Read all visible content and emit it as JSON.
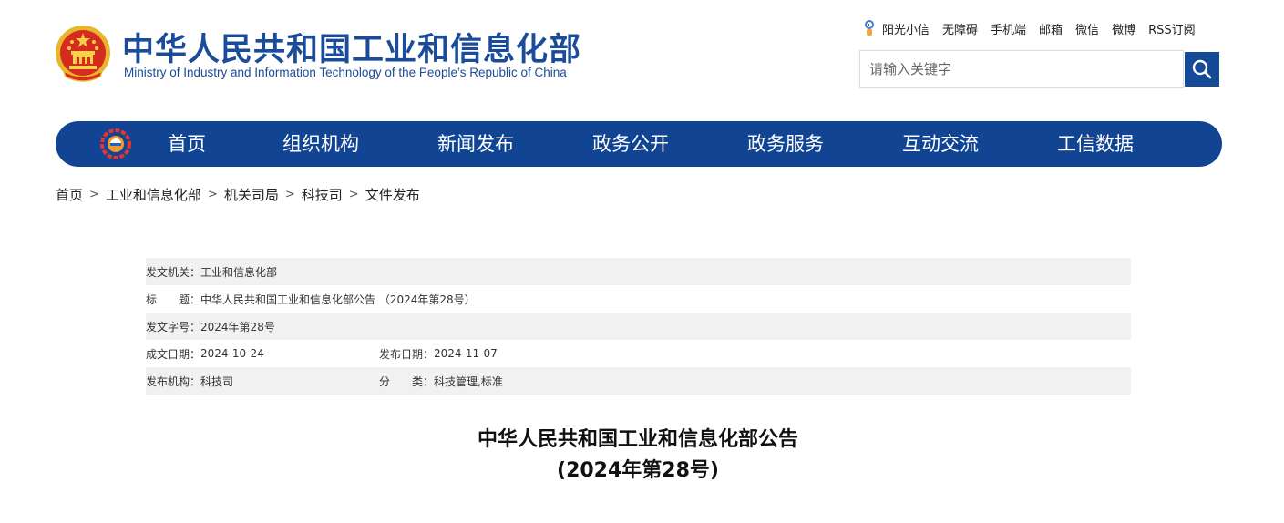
{
  "header": {
    "site_title_cn": "中华人民共和国工业和信息化部",
    "site_title_en": "Ministry of Industry and Information Technology of the People’s Republic of China"
  },
  "toplinks": [
    "阳光小信",
    "无障碍",
    "手机端",
    "邮箱",
    "微信",
    "微博",
    "RSS订阅"
  ],
  "search": {
    "placeholder": "请输入关键字",
    "value": ""
  },
  "nav": {
    "items": [
      "首页",
      "组织机构",
      "新闻发布",
      "政务公开",
      "政务服务",
      "互动交流",
      "工信数据"
    ]
  },
  "breadcrumb": [
    "首页",
    "工业和信息化部",
    "机关司局",
    "科技司",
    "文件发布"
  ],
  "breadcrumb_separator": ">",
  "meta": {
    "issuer_label": "发文机关：",
    "issuer_value": "工业和信息化部",
    "title_label": "标　　题：",
    "title_value": "中华人民共和国工业和信息化部公告 （2024年第28号）",
    "doc_no_label": "发文字号：",
    "doc_no_value": "2024年第28号",
    "written_date_label": "成文日期：",
    "written_date_value": "2024-10-24",
    "publish_date_label": "发布日期：",
    "publish_date_value": "2024-11-07",
    "publisher_label": "发布机构：",
    "publisher_value": "科技司",
    "category_label": "分　　类：",
    "category_value": "科技管理,标准"
  },
  "document": {
    "title_line1": "中华人民共和国工业和信息化部公告",
    "title_line2": "(2024年第28号)"
  },
  "colors": {
    "brand_blue": "#1a4c9a",
    "nav_blue": "#114594",
    "search_button": "#154a96",
    "meta_shade": "#f1f1f1"
  },
  "icons": {
    "emblem": "national-emblem-icon",
    "mascot": "sunshine-mascot-icon",
    "search": "search-icon",
    "nav_logo": "miit-logo-icon"
  }
}
